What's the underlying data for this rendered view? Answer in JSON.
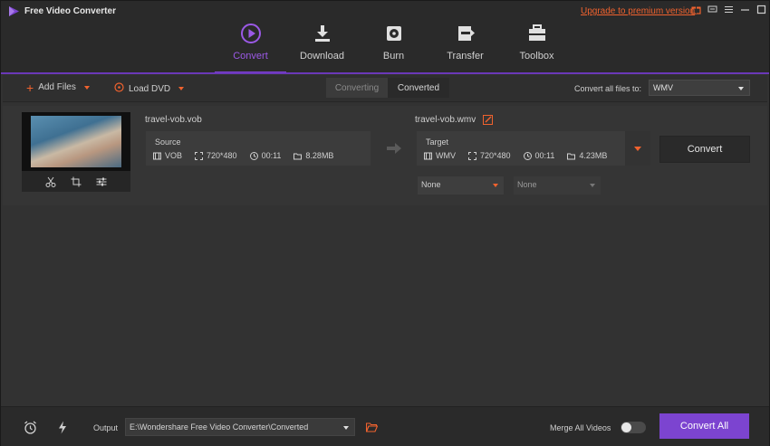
{
  "app": {
    "title": "Free Video Converter",
    "upgrade_link": "Upgrade to premium version"
  },
  "nav": {
    "tabs": [
      {
        "label": "Convert",
        "icon": "convert-play-icon",
        "active": true
      },
      {
        "label": "Download",
        "icon": "download-icon",
        "active": false
      },
      {
        "label": "Burn",
        "icon": "burn-disc-icon",
        "active": false
      },
      {
        "label": "Transfer",
        "icon": "transfer-icon",
        "active": false
      },
      {
        "label": "Toolbox",
        "icon": "toolbox-icon",
        "active": false
      }
    ]
  },
  "toolbar": {
    "add_files": "Add Files",
    "load_dvd": "Load DVD",
    "tab_converting": "Converting",
    "tab_converted": "Converted",
    "convert_all_to_label": "Convert all files to:",
    "format_value": "WMV"
  },
  "item": {
    "source_name": "travel-vob.vob",
    "target_name": "travel-vob.wmv",
    "source": {
      "label": "Source",
      "format": "VOB",
      "resolution": "720*480",
      "duration": "00:11",
      "size": "8.28MB"
    },
    "target": {
      "label": "Target",
      "format": "WMV",
      "resolution": "720*480",
      "duration": "00:11",
      "size": "4.23MB"
    },
    "convert_label": "Convert",
    "subtitle_select": "None",
    "audio_select": "None"
  },
  "bottom": {
    "output_label": "Output",
    "output_path": "E:\\Wondershare Free Video Converter\\Converted",
    "merge_label": "Merge All Videos",
    "merge_on": false,
    "convert_all_label": "Convert All"
  },
  "colors": {
    "accent_purple": "#7c44d0",
    "accent_orange": "#f0622e",
    "background": "#323232"
  }
}
